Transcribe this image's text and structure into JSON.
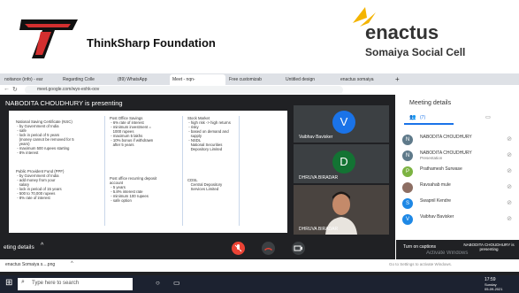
{
  "header": {
    "left_org": "ThinkSharp Foundation",
    "right_org_word": "enactus",
    "right_org_sub": "Somaiya Social Cell"
  },
  "browser": {
    "tabs": [
      "noitance (info) - ear",
      "Regarding Colle",
      "(89) WhatsApp",
      "Meet - nqn-",
      "Free customizab",
      "Untitled design",
      "enactus somaiya"
    ],
    "url": "meet.google.com/wyx-exhk-oov"
  },
  "meet": {
    "presenting_banner": "NABODITA CHOUDHURY is presenting",
    "slide": {
      "col1a": "National Saving Certificate (NSC)\n - by Government of India\n - safe\n - lock in period of 5 years\n   (money cannot be removed for 5\n   years)\n - maximum 500 rupees starting\n - 8% interest",
      "col1b": "Public Provident Fund (PPF)\n - by Government of India\n - add money from your\n   salary\n - lock in period of 15 years\n - 500 to 70,000 rupees\n - 8% rate of interest",
      "col2a": "Post Office Savings\n - 6% rate of interest\n - minimum investment =\n   1000 rupees\n - maximum 5 lakhs\n - 10% bonus if withdrawn\n   after 5 years",
      "col2b": "Post office recurring deposit\naccount\n - 5 years\n - 5.8% interest rate\n - minimum 100 rupees\n - safe option",
      "col3a": "Stock Market\n - high risk -> high returns\n - risky\n - based on demand and\n   supply\n - NSDL\n   National Securities\n   Depository Limited",
      "col3b": "CDSL\n   Central Depository\n   Services Limited"
    },
    "tiles": [
      {
        "initial": "V",
        "name": "Vaibhav Bavisker"
      },
      {
        "initial": "D",
        "name": "DHRUVA BIRADAR"
      },
      {
        "initial": "",
        "name": "DHRUVA BIRADAR"
      }
    ],
    "meeting_details_label": "eting details",
    "captions_label": "Turn on captions",
    "presenting_footer": "NABODITA CHOUDHURY is presenting"
  },
  "panel": {
    "title": "Meeting details",
    "people_count": "(7)",
    "participants": [
      {
        "initial": "N",
        "name": "NABODITA CHOUDHURY",
        "sub": "",
        "color": "#5f7a8a"
      },
      {
        "initial": "N",
        "name": "NABODITA CHOUDHURY",
        "sub": "Presentation",
        "color": "#5f7a8a"
      },
      {
        "initial": "P",
        "name": "Prathamesh Surwase",
        "sub": "",
        "color": "#7cb342"
      },
      {
        "initial": "",
        "name": "Ravsahab mule",
        "sub": "",
        "color": "#8d6e63"
      },
      {
        "initial": "S",
        "name": "Swapnil Kendre",
        "sub": "",
        "color": "#1e88e5"
      },
      {
        "initial": "V",
        "name": "Vaibhav Bavisker",
        "sub": "",
        "color": "#1e88e5"
      }
    ],
    "watermark_title": "Activate Windows",
    "watermark_sub": "Go to Settings to activate Windows."
  },
  "downloads": {
    "file": "enactus Somaiya s....png"
  },
  "taskbar": {
    "search_placeholder": "Type here to search",
    "time": "17:59",
    "day": "Sunday",
    "date": "05-09-2021"
  },
  "colors": {
    "meet_dark": "#202124",
    "tile": "#3c4043",
    "end_call": "#ea4335",
    "avatar_blue": "#1a73e8",
    "avatar_green": "#137333"
  }
}
